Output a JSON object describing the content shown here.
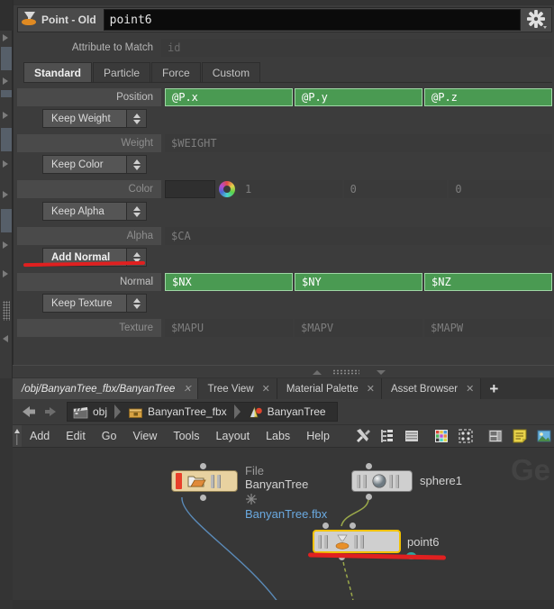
{
  "parameter_pane": {
    "node_header": {
      "icon": "point-funnel-icon",
      "type_label": "Point - Old",
      "node_name": "point6",
      "gear_icon": "gear-icon"
    },
    "attribute_to_match": {
      "label": "Attribute to Match",
      "value": "id"
    },
    "tabs": [
      {
        "label": "Standard",
        "active": true
      },
      {
        "label": "Particle",
        "active": false
      },
      {
        "label": "Force",
        "active": false
      },
      {
        "label": "Custom",
        "active": false
      }
    ],
    "rows": [
      {
        "kind": "field_row",
        "label": "Position",
        "dim": false,
        "fields": [
          {
            "value": "@P.x",
            "style": "green"
          },
          {
            "value": "@P.y",
            "style": "green"
          },
          {
            "value": "@P.z",
            "style": "green"
          }
        ]
      },
      {
        "kind": "menu",
        "label": "Keep Weight",
        "bold": false,
        "annotated": false
      },
      {
        "kind": "field_row",
        "label": "Weight",
        "dim": true,
        "fields": [
          {
            "value": "$WEIGHT",
            "style": "plain"
          }
        ]
      },
      {
        "kind": "menu",
        "label": "Keep Color",
        "bold": false,
        "annotated": false
      },
      {
        "kind": "color_row",
        "label": "Color",
        "dim": true,
        "swatch_color": "#2f2f2f",
        "wheel_icon": "color-wheel-icon",
        "fields": [
          {
            "value": "1",
            "style": "plain"
          },
          {
            "value": "0",
            "style": "plain"
          },
          {
            "value": "0",
            "style": "plain"
          }
        ]
      },
      {
        "kind": "menu",
        "label": "Keep Alpha",
        "bold": false,
        "annotated": false
      },
      {
        "kind": "field_row",
        "label": "Alpha",
        "dim": true,
        "fields": [
          {
            "value": "$CA",
            "style": "plain"
          }
        ]
      },
      {
        "kind": "menu",
        "label": "Add Normal",
        "bold": true,
        "annotated": true
      },
      {
        "kind": "field_row",
        "label": "Normal",
        "dim": false,
        "fields": [
          {
            "value": "$NX",
            "style": "green"
          },
          {
            "value": "$NY",
            "style": "green"
          },
          {
            "value": "$NZ",
            "style": "green"
          }
        ]
      },
      {
        "kind": "menu",
        "label": "Keep Texture",
        "bold": false,
        "annotated": false
      },
      {
        "kind": "field_row",
        "label": "Texture",
        "dim": true,
        "fields": [
          {
            "value": "$MAPU",
            "style": "plain"
          },
          {
            "value": "$MAPV",
            "style": "plain"
          },
          {
            "value": "$MAPW",
            "style": "plain"
          }
        ]
      }
    ]
  },
  "network_editor": {
    "tabs": [
      {
        "label": "/obj/BanyanTree_fbx/BanyanTree",
        "active": true,
        "close_icon": "close-icon"
      },
      {
        "label": "Tree View",
        "active": false,
        "close_icon": "close-icon"
      },
      {
        "label": "Material Palette",
        "active": false,
        "close_icon": "close-icon"
      },
      {
        "label": "Asset Browser",
        "active": false,
        "close_icon": "close-icon"
      }
    ],
    "new_tab_label": "+",
    "breadcrumb": [
      {
        "label": "obj",
        "icon": "clapperboard-icon"
      },
      {
        "label": "BanyanTree_fbx",
        "icon": "package-icon"
      },
      {
        "label": "BanyanTree",
        "icon": "geometry-icon"
      }
    ],
    "nav_back_icon": "arrow-left-icon",
    "nav_forward_icon": "arrow-right-icon",
    "menu_items": [
      "Add",
      "Edit",
      "Go",
      "View",
      "Tools",
      "Layout",
      "Labs",
      "Help"
    ],
    "toolbar_icons": [
      "tools-icon",
      "hierarchy-icon",
      "list-icon",
      "color-palette-icon",
      "grid-select-icon",
      "layout-panes-icon",
      "notes-icon",
      "image-icon"
    ],
    "watermark": "Ge",
    "nodes": [
      {
        "name": "BanyanTree",
        "label_top": "File",
        "label_sub": "BanyanTree.fbx",
        "sub_icon": "snowflake-icon",
        "color": "#e8d2a0",
        "flag_color": "#e8402a",
        "icon": "file-folder-icon",
        "selected": false
      },
      {
        "name": "sphere1",
        "color": "#d4d4d4",
        "icon": "sphere-icon",
        "selected": false
      },
      {
        "name": "point6",
        "color": "#d4d4d4",
        "icon": "point-funnel-icon",
        "selected": true,
        "selection_color": "#f2c200",
        "badge_color": "#2aa7a0",
        "annotated": true
      }
    ],
    "annotation_color": "#e02020"
  }
}
